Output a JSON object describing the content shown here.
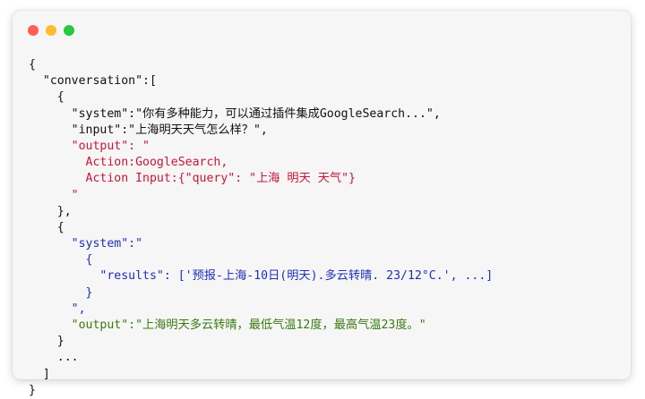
{
  "window": {
    "colors": {
      "close": "#ff5f57",
      "minimize": "#febc2e",
      "maximize": "#28c840",
      "text": "#111111",
      "output_red": "#c4163a",
      "system_blue": "#1f2fb8",
      "output_green": "#3a7a12"
    }
  },
  "code": {
    "lines": [
      "{",
      "  \"conversation\":[",
      "    {",
      "      \"system\":\"你有多种能力，可以通过插件集成GoogleSearch...\",",
      "      \"input\":\"上海明天天气怎么样？\",",
      "      \"output\": \"",
      "        Action:GoogleSearch,",
      "        Action Input:{\"query\": \"上海 明天 天气\"}",
      "      \"",
      "    },",
      "    {",
      "      \"system\":\"",
      "        {",
      "          \"results\": ['预报-上海-10日(明天).多云转晴. 23/12°C.', ...]",
      "        }",
      "      \",",
      "      \"output\":\"上海明天多云转晴，最低气温12度，最高气温23度。\"",
      "    }",
      "    ...",
      "  ]",
      "}"
    ]
  }
}
